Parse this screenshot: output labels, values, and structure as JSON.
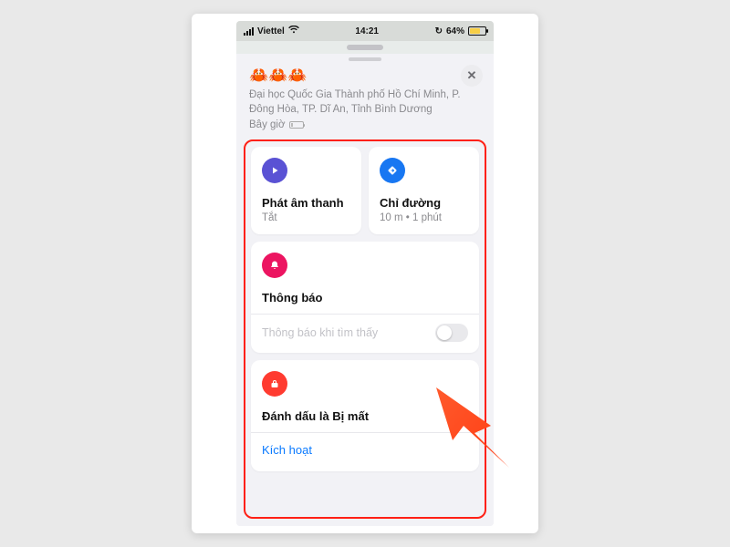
{
  "statusbar": {
    "carrier": "Viettel",
    "time": "14:21",
    "battery_pct": "64%",
    "low_power": true
  },
  "sheet": {
    "title_emoji": "🦀🦀🦀",
    "address_line1": "Đại học Quốc Gia Thành phố Hồ Chí Minh, P.",
    "address_line2": "Đông Hòa, TP. Dĩ An, Tỉnh Bình Dương",
    "now_label": "Bây giờ",
    "close_glyph": "✕"
  },
  "cards": {
    "sound": {
      "title": "Phát âm thanh",
      "subtitle": "Tắt"
    },
    "directions": {
      "title": "Chỉ đường",
      "subtitle": "10 m • 1 phút"
    },
    "notifications": {
      "title": "Thông báo",
      "option_label": "Thông báo khi tìm thấy",
      "toggle_on": false
    },
    "lost": {
      "title": "Đánh dấu là Bị mất",
      "activate_label": "Kích hoạt"
    }
  },
  "annotation": {
    "arrow_color": "#ff4a1c"
  }
}
